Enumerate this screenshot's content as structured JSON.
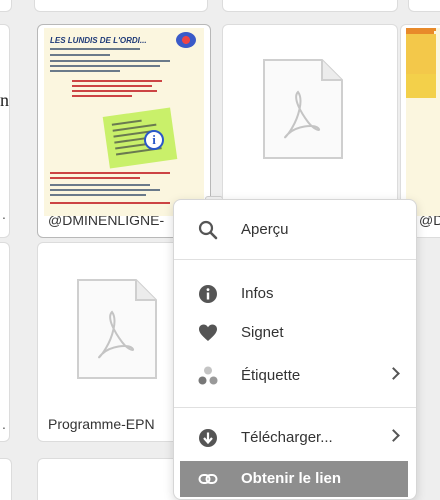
{
  "files": {
    "doc1_name": "@DMINENLIGNE-",
    "doc2_name": "Programme-EPN",
    "right_name_partial": "@D",
    "flyer_title": "LES LUNDIS DE L'ORDI..."
  },
  "left_edge": {
    "stub1": ".",
    "stub2": "n",
    "stub3": "."
  },
  "context_menu": {
    "items": [
      {
        "label": "Aperçu",
        "icon": "search-icon"
      },
      {
        "label": "Infos",
        "icon": "info-icon"
      },
      {
        "label": "Signet",
        "icon": "heart-icon"
      },
      {
        "label": "Étiquette",
        "icon": "tag-dots-icon",
        "has_submenu": true
      },
      {
        "label": "Télécharger...",
        "icon": "download-icon",
        "has_submenu": true
      },
      {
        "label": "Obtenir le lien",
        "icon": "link-icon",
        "active": true
      }
    ]
  },
  "colors": {
    "menu_active_bg": "#8e8e8e",
    "flyer_bg": "#fbf6df",
    "flyer_green": "#c9f06a"
  }
}
